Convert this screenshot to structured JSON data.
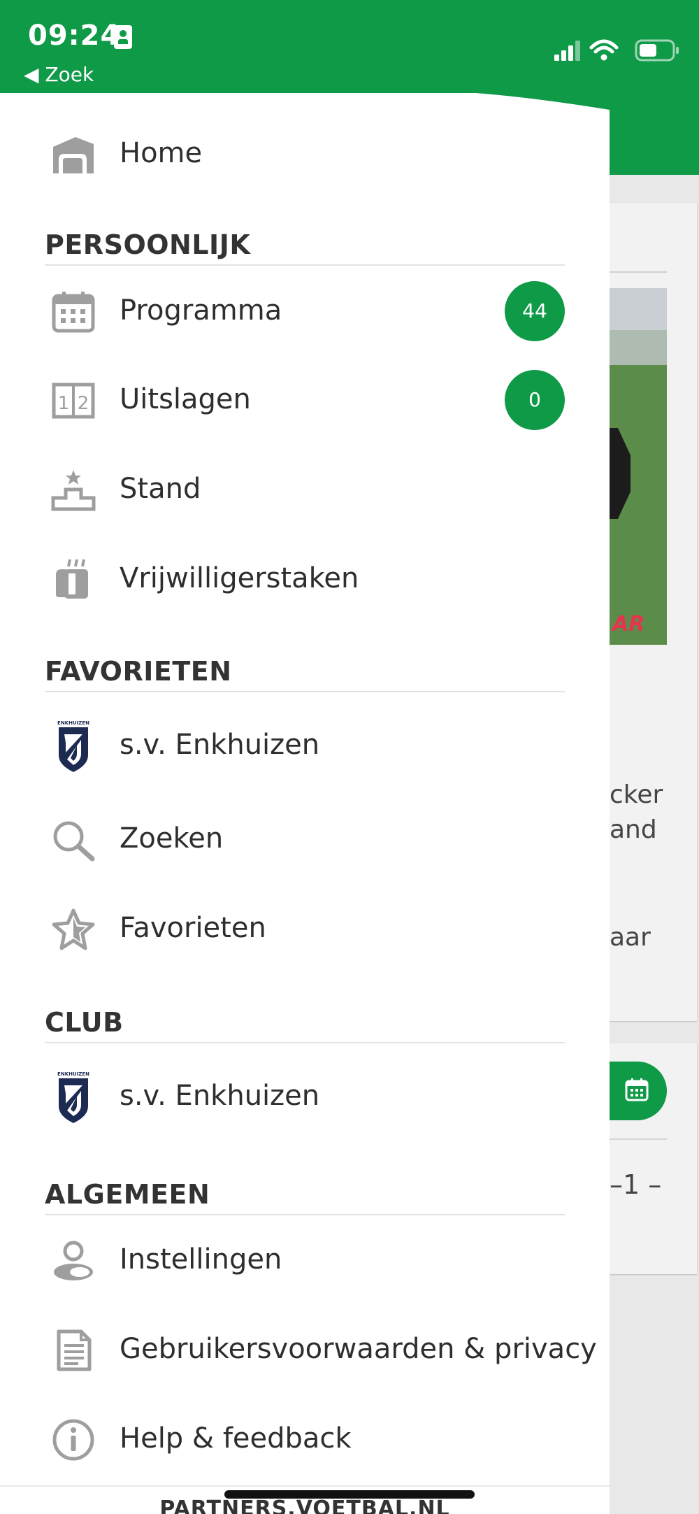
{
  "status_bar": {
    "time": "09:24",
    "back_label": "Zoek"
  },
  "colors": {
    "brand_green": "#0f9a48",
    "icon_gray": "#9e9e9e",
    "bg_accent_red": "#e8334f"
  },
  "menu": {
    "home": {
      "label": "Home",
      "icon": "home-icon"
    },
    "sections": {
      "persoonlijk": "PERSOONLIJK",
      "favorieten": "FAVORIETEN",
      "club": "CLUB",
      "algemeen": "ALGEMEEN"
    },
    "persoonlijk_items": {
      "programma": {
        "label": "Programma",
        "count": "44",
        "icon": "calendar-icon"
      },
      "uitslagen": {
        "label": "Uitslagen",
        "count": "0",
        "icon": "score-icon"
      },
      "stand": {
        "label": "Stand",
        "icon": "podium-icon"
      },
      "vrijwilligerstaken": {
        "label": "Vrijwilligerstaken",
        "icon": "mug-icon"
      }
    },
    "favorieten_items": {
      "club": {
        "label": "s.v. Enkhuizen",
        "icon": "club-logo",
        "logo_text": "ENKHUIZEN"
      },
      "zoeken": {
        "label": "Zoeken",
        "icon": "search-icon"
      },
      "favorieten": {
        "label": "Favorieten",
        "icon": "star-icon"
      }
    },
    "club_items": {
      "club": {
        "label": "s.v. Enkhuizen",
        "icon": "club-logo",
        "logo_text": "ENKHUIZEN"
      }
    },
    "algemeen_items": {
      "instellingen": {
        "label": "Instellingen",
        "icon": "user-icon"
      },
      "voorwaarden": {
        "label": "Gebruikersvoorwaarden & privacy",
        "icon": "document-icon"
      },
      "help": {
        "label": "Help & feedback",
        "icon": "info-icon"
      }
    }
  },
  "footer": {
    "partners": "PARTNERS.VOETBAL.NL"
  },
  "background": {
    "photo_text": "AR",
    "text_1": "cker",
    "text_2": "and",
    "text_3": "aar",
    "score": "–1 –"
  }
}
